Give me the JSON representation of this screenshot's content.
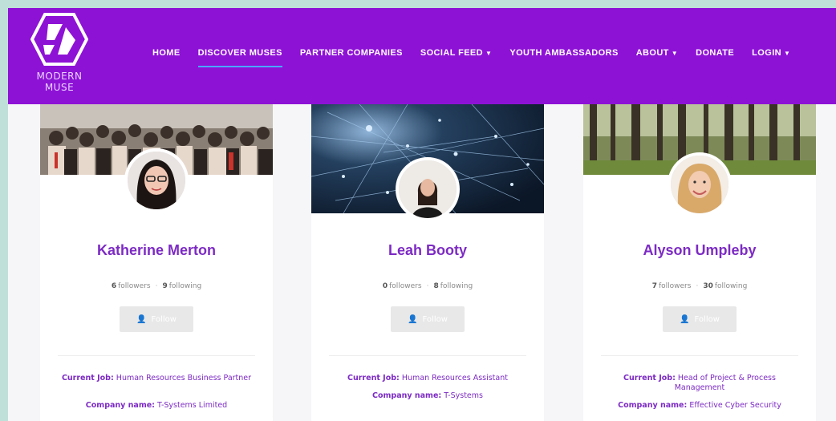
{
  "brand": {
    "logo_icon": "modern-muse-logo-icon",
    "name_line1": "MODERN",
    "name_line2": "MUSE",
    "color": "#8e12d6"
  },
  "nav": {
    "items": [
      {
        "label": "HOME"
      },
      {
        "label": "DISCOVER MUSES",
        "active": true
      },
      {
        "label": "PARTNER COMPANIES"
      },
      {
        "label": "SOCIAL FEED",
        "has_dropdown": true
      },
      {
        "label": "YOUTH AMBASSADORS"
      },
      {
        "label": "ABOUT",
        "has_dropdown": true
      },
      {
        "label": "DONATE"
      },
      {
        "label": "LOGIN",
        "has_dropdown": true
      }
    ],
    "active_underline_color": "#4aa8ff"
  },
  "muses": [
    {
      "name": "Katherine Merton",
      "followers": "6",
      "followers_label": "followers",
      "following": "9",
      "following_label": "following",
      "follow_label": "Follow",
      "job_label": "Current Job:",
      "job": "Human Resources Business Partner",
      "company_label": "Company name:",
      "company": "T-Systems Limited",
      "banner": "group-photo"
    },
    {
      "name": "Leah Booty",
      "followers": "0",
      "followers_label": "followers",
      "following": "8",
      "following_label": "following",
      "follow_label": "Follow",
      "job_label": "Current Job:",
      "job": "Human Resources Assistant",
      "company_label": "Company name:",
      "company": "T-Systems",
      "banner": "network-nodes"
    },
    {
      "name": "Alyson Umpleby",
      "followers": "7",
      "followers_label": "followers",
      "following": "30",
      "following_label": "following",
      "follow_label": "Follow",
      "job_label": "Current Job:",
      "job": "Head of Project & Process Management",
      "company_label": "Company name:",
      "company": "Effective Cyber Security",
      "banner": "forest"
    }
  ],
  "colors": {
    "name": "#7d2bc4",
    "page_bg": "#bfe0d8"
  }
}
